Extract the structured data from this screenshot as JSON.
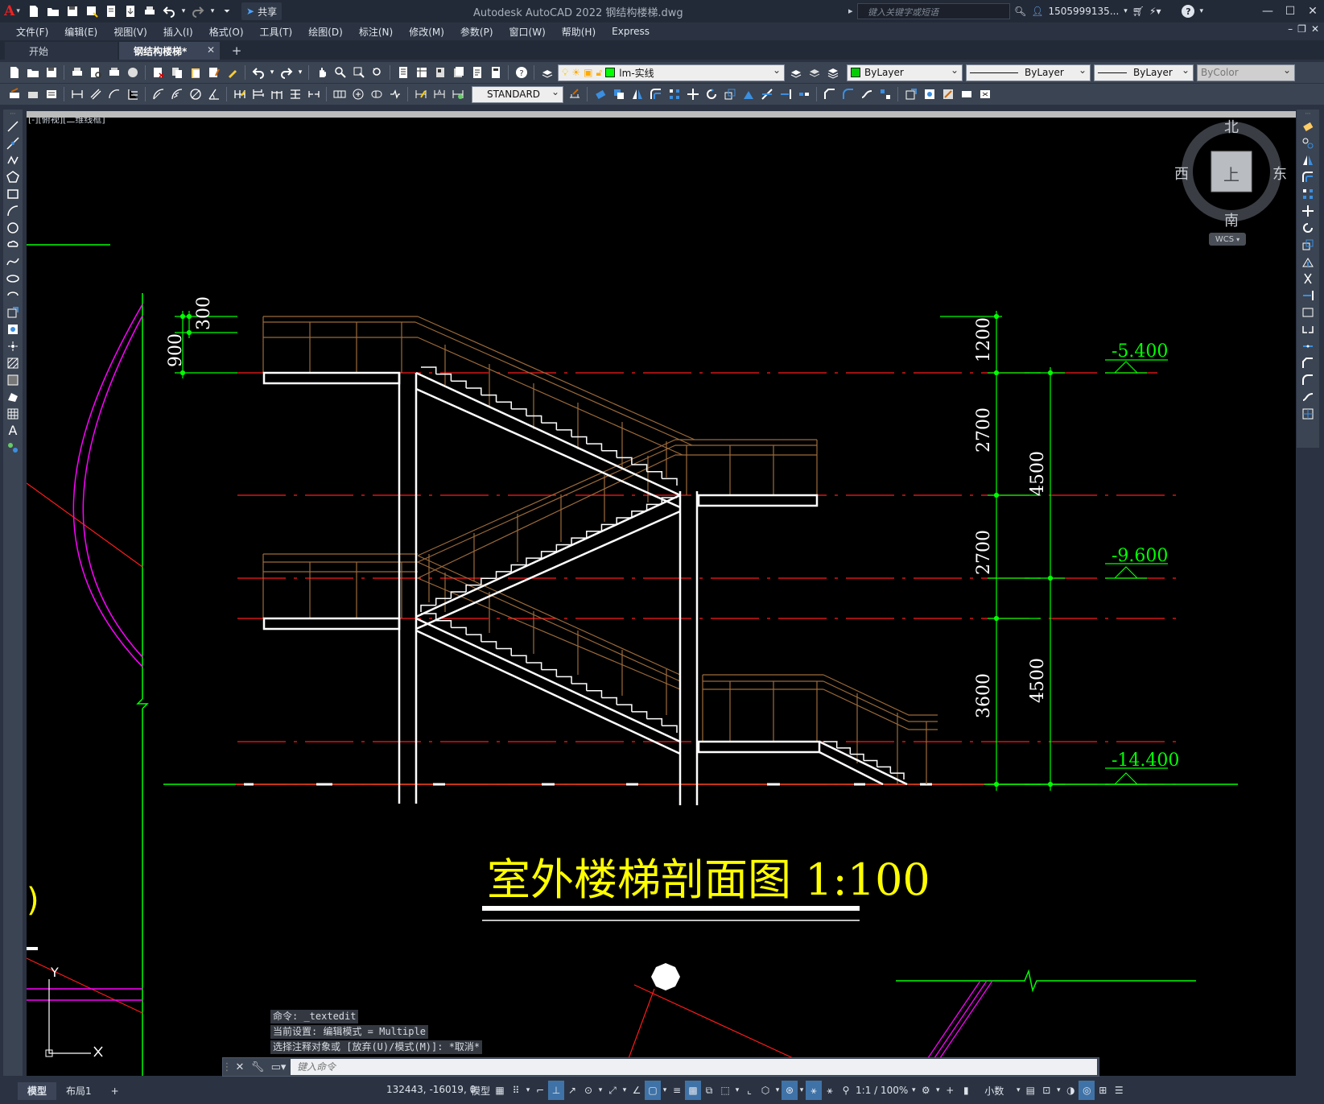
{
  "app": {
    "window_title": "Autodesk AutoCAD 2022    钢结构楼梯.dwg",
    "share_label": "共享",
    "search_placeholder": "键入关键字或短语",
    "user_name": "1505999135..."
  },
  "menu": [
    "文件(F)",
    "编辑(E)",
    "视图(V)",
    "插入(I)",
    "格式(O)",
    "工具(T)",
    "绘图(D)",
    "标注(N)",
    "修改(M)",
    "参数(P)",
    "窗口(W)",
    "帮助(H)",
    "Express"
  ],
  "tabs": {
    "start": "开始",
    "active": "钢结构楼梯*",
    "close": "✕",
    "add": "+"
  },
  "toolbar": {
    "layer_name": "lm-实线",
    "layer_color": "#00ff00",
    "color_value": "ByLayer",
    "color_swatch": "#00cc00",
    "linetype_value": "ByLayer",
    "lineweight_value": "ByLayer",
    "plotstyle_value": "ByColor",
    "textstyle_value": "STANDARD"
  },
  "viewport": {
    "label": "[-][俯视][二维线框]"
  },
  "viewcube": {
    "north": "北",
    "south": "南",
    "east": "东",
    "west": "西",
    "top": "上",
    "wcs": "WCS"
  },
  "drawing": {
    "title": "室外楼梯剖面图 1:100",
    "dims_left": [
      "300",
      "900"
    ],
    "dims_right_inner": [
      "1200",
      "2700",
      "2700",
      "3600"
    ],
    "dims_right_outer": [
      "4500",
      "4500"
    ],
    "elevations": [
      "-5.400",
      "-9.600",
      "-14.400"
    ],
    "axis_y": "Y",
    "colors": {
      "stair": "#ffffff",
      "rail": "#9b6a3a",
      "axis_red": "#ff1a1a",
      "dim_green": "#00ff00",
      "text_yellow": "#ffff00",
      "arc_magenta": "#ff00ff"
    }
  },
  "command": {
    "history": [
      "命令: _textedit",
      "当前设置: 编辑模式 = Multiple",
      "选择注释对象或 [放弃(U)/模式(M)]: *取消*"
    ],
    "placeholder": "键入命令"
  },
  "status": {
    "model_tab": "模型",
    "layout_tab": "布局1",
    "add_tab": "+",
    "coords": "132443, -16019, 0",
    "model_label": "模型",
    "scale": "1:1 / 100%",
    "units": "小数"
  }
}
